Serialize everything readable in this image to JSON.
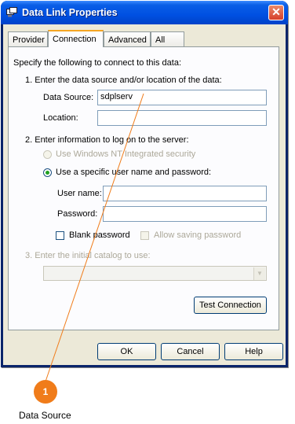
{
  "window": {
    "title": "Data Link Properties",
    "close_glyph": "✕",
    "title_icon": "data-link-icon"
  },
  "tabs": [
    {
      "label": "Provider",
      "active": false
    },
    {
      "label": "Connection",
      "active": true
    },
    {
      "label": "Advanced",
      "active": false
    },
    {
      "label": "All",
      "active": false
    }
  ],
  "connection": {
    "intro": "Specify the following to connect to this data:",
    "step1": "1. Enter the data source and/or location of the data:",
    "data_source_label": "Data Source:",
    "data_source_value": "sdplserv",
    "location_label": "Location:",
    "location_value": "",
    "step2": "2. Enter information to log on to the server:",
    "radio_nt": "Use Windows NT Integrated security",
    "radio_specific": "Use a specific user name and password:",
    "username_label": "User name:",
    "username_value": "",
    "password_label": "Password:",
    "password_value": "",
    "blank_password": "Blank password",
    "allow_saving": "Allow saving password",
    "step3": "3. Enter the initial catalog to use:",
    "catalog_value": "",
    "test_connection": "Test Connection"
  },
  "buttons": {
    "ok": "OK",
    "cancel": "Cancel",
    "help": "Help"
  },
  "callout": {
    "number": "1",
    "label": "Data Source",
    "color": "#f07c1a"
  }
}
